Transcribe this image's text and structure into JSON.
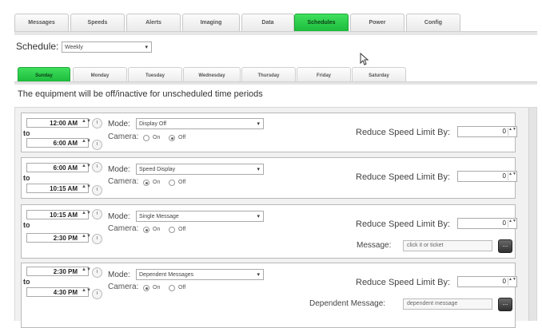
{
  "top_tabs": [
    "Messages",
    "Speeds",
    "Alerts",
    "Imaging",
    "Data",
    "Schedules",
    "Power",
    "Config"
  ],
  "active_top_tab": "Schedules",
  "schedule": {
    "label": "Schedule:",
    "value": "Weekly",
    "arrow": "▾"
  },
  "day_tabs": [
    "Sunday",
    "Monday",
    "Tuesday",
    "Wednesday",
    "Thursday",
    "Friday",
    "Saturday"
  ],
  "active_day_tab": "Sunday",
  "notice": "The equipment will be off/inactive for unscheduled time periods",
  "labels": {
    "to": "to",
    "mode": "Mode:",
    "camera": "Camera:",
    "on": "On",
    "off": "Off",
    "reduce_speed": "Reduce Speed Limit By:",
    "spin": "▲▼",
    "arrow": "▾",
    "ellipsis": "..."
  },
  "entries": [
    {
      "start": "12:00 AM",
      "end": "6:00 AM",
      "mode": "Display Off",
      "camera": "off",
      "reduce_speed": "0"
    },
    {
      "start": "6:00 AM",
      "end": "10:15 AM",
      "mode": "Speed Display",
      "camera": "on",
      "reduce_speed": "0"
    },
    {
      "start": "10:15 AM",
      "end": "2:30 PM",
      "mode": "Single Message",
      "camera": "on",
      "reduce_speed": "0",
      "message_label": "Message:",
      "message_value": "click it or ticket"
    },
    {
      "start": "2:30 PM",
      "end": "4:30 PM",
      "mode": "Dependent Messages",
      "camera": "on",
      "reduce_speed": "0",
      "message_label": "Dependent Message:",
      "message_value": "dependent message"
    }
  ]
}
